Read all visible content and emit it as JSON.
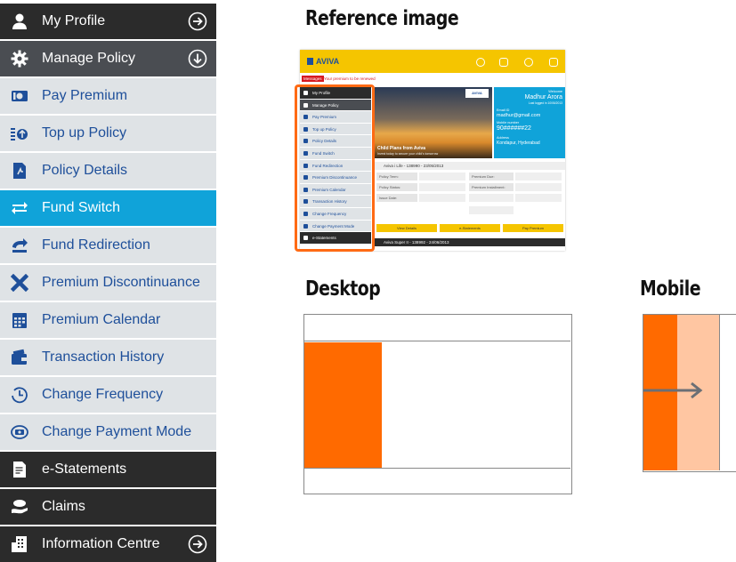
{
  "sidebar": {
    "items": [
      {
        "label": "My Profile",
        "icon": "user-icon",
        "trail": "arrow-right-circle-icon"
      },
      {
        "label": "Manage Policy",
        "icon": "gear-icon",
        "trail": "arrow-down-circle-icon"
      },
      {
        "label": "Pay Premium",
        "icon": "cash-icon"
      },
      {
        "label": "Top up Policy",
        "icon": "top-up-icon"
      },
      {
        "label": "Policy Details",
        "icon": "document-icon"
      },
      {
        "label": "Fund Switch",
        "icon": "switch-arrows-icon"
      },
      {
        "label": "Fund Redirection",
        "icon": "redirect-icon"
      },
      {
        "label": "Premium Discontinuance",
        "icon": "x-icon"
      },
      {
        "label": "Premium Calendar",
        "icon": "calendar-icon"
      },
      {
        "label": "Transaction History",
        "icon": "wallet-icon"
      },
      {
        "label": "Change Frequency",
        "icon": "clock-icon"
      },
      {
        "label": "Change Payment Mode",
        "icon": "payment-mode-icon"
      },
      {
        "label": "e-Statements",
        "icon": "statement-icon"
      },
      {
        "label": "Claims",
        "icon": "claims-icon"
      },
      {
        "label": "Information Centre",
        "icon": "building-icon",
        "trail": "arrow-right-circle-icon"
      }
    ],
    "active": "Fund Switch"
  },
  "headings": {
    "reference": "Reference image",
    "desktop": "Desktop",
    "mobile": "Mobile"
  },
  "reference": {
    "logo": "AVIVA",
    "message_badge": "Messages",
    "message": "Your premium to be renewed",
    "photo_caption": "Child Plans from Aviva",
    "photo_subcaption": "Invest today to secure your child's tomorrow",
    "welcome": "Welcome",
    "name": "Madhur Arora",
    "last_logged": "Last logged in 10/06/2013",
    "email_label": "Email ID",
    "email": "madhur@gmail.com",
    "mobile_label": "Mobile number",
    "mobile": "90######22",
    "address_label": "Address",
    "address": "Kondapur, Hyderabad",
    "policy1": "Aviva i Life - 138990 - 23/05/2013",
    "policy2": "Aviva Super II - 138992 - 24/06/2013",
    "fields": [
      "Policy Term:",
      "Policy Status:",
      "Issue Date:",
      "Premium Due:",
      "Premium Installment:"
    ],
    "buttons": [
      "View Details",
      "e-Statements",
      "Pay Premium"
    ],
    "menu": [
      "My Profile",
      "Manage Policy",
      "Pay Premium",
      "Top up Policy",
      "Policy Details",
      "Fund Switch",
      "Fund Redirection",
      "Premium Discontinuance",
      "Premium Calendar",
      "Transaction History",
      "Change Frequency",
      "Change Payment Mode",
      "e-Statements"
    ]
  },
  "colors": {
    "dark": "#2b2b2b",
    "mid": "#4a4d52",
    "light": "#dfe3e6",
    "active": "#10a3d9",
    "link": "#1e4f9a",
    "accent": "#ff6a00",
    "brand_yellow": "#f5c500"
  }
}
